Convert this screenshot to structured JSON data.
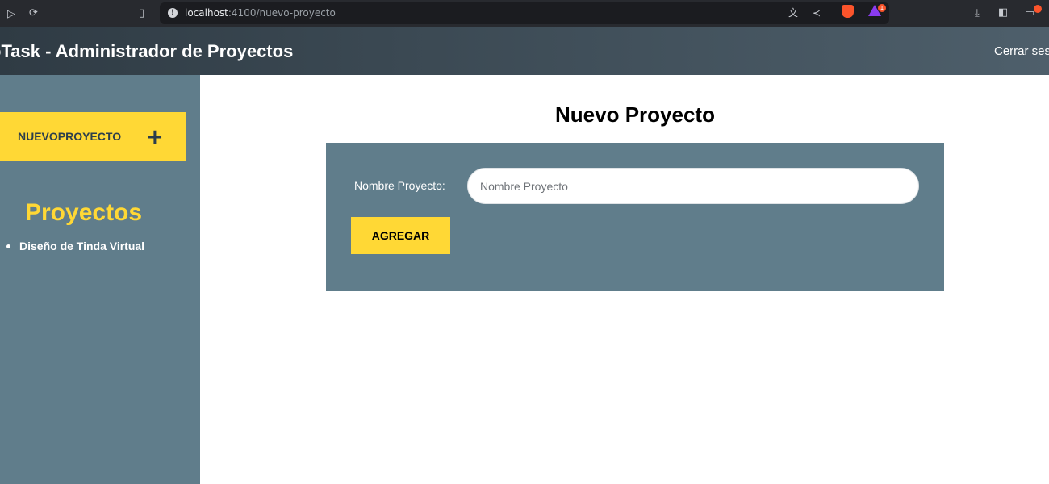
{
  "browser": {
    "url_host": "localhost",
    "url_path": ":4100/nuevo-proyecto",
    "rewards_badge": "1"
  },
  "header": {
    "title": "oTask - Administrador de Proyectos",
    "logout_label": "Cerrar ses"
  },
  "sidebar": {
    "new_project_label": "NUEVOPROYECTO",
    "new_project_icon": "plus-icon",
    "projects_title": "Proyectos",
    "projects": [
      {
        "name": "Diseño de Tinda Virtual"
      }
    ]
  },
  "main": {
    "title": "Nuevo Proyecto",
    "form": {
      "name_label": "Nombre Proyecto:",
      "name_placeholder": "Nombre Proyecto",
      "name_value": "",
      "submit_label": "AGREGAR"
    }
  },
  "colors": {
    "accent_yellow": "#ffd835",
    "sidebar_bg": "#607d8b",
    "header_dark": "#2f3b44"
  }
}
